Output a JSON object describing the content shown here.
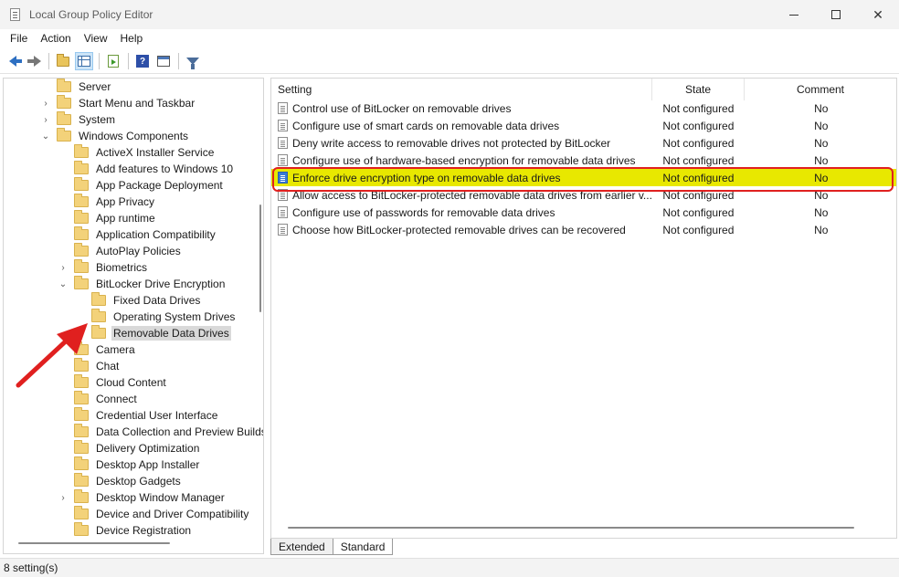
{
  "window": {
    "title": "Local Group Policy Editor",
    "controls": {
      "minimize": "minimize",
      "maximize": "maximize",
      "close": "✕"
    }
  },
  "menubar": [
    "File",
    "Action",
    "View",
    "Help"
  ],
  "toolbar": {
    "buttons": [
      "back-icon",
      "forward-icon",
      "up-folder-icon",
      "show-hide-tree-icon",
      "export-list-icon",
      "help-icon",
      "properties-icon",
      "filter-icon"
    ]
  },
  "tree": [
    {
      "label": "Server",
      "chevron": ""
    },
    {
      "label": "Start Menu and Taskbar",
      "chevron": "›"
    },
    {
      "label": "System",
      "chevron": "›"
    },
    {
      "label": "Windows Components",
      "chevron": "⌄"
    },
    {
      "label": "ActiveX Installer Service",
      "chevron": ""
    },
    {
      "label": "Add features to Windows 10",
      "chevron": ""
    },
    {
      "label": "App Package Deployment",
      "chevron": ""
    },
    {
      "label": "App Privacy",
      "chevron": ""
    },
    {
      "label": "App runtime",
      "chevron": ""
    },
    {
      "label": "Application Compatibility",
      "chevron": ""
    },
    {
      "label": "AutoPlay Policies",
      "chevron": ""
    },
    {
      "label": "Biometrics",
      "chevron": "›"
    },
    {
      "label": "BitLocker Drive Encryption",
      "chevron": "⌄"
    },
    {
      "label": "Fixed Data Drives",
      "chevron": ""
    },
    {
      "label": "Operating System Drives",
      "chevron": ""
    },
    {
      "label": "Removable Data Drives",
      "chevron": ""
    },
    {
      "label": "Camera",
      "chevron": ""
    },
    {
      "label": "Chat",
      "chevron": ""
    },
    {
      "label": "Cloud Content",
      "chevron": ""
    },
    {
      "label": "Connect",
      "chevron": ""
    },
    {
      "label": "Credential User Interface",
      "chevron": ""
    },
    {
      "label": "Data Collection and Preview Builds",
      "chevron": ""
    },
    {
      "label": "Delivery Optimization",
      "chevron": ""
    },
    {
      "label": "Desktop App Installer",
      "chevron": ""
    },
    {
      "label": "Desktop Gadgets",
      "chevron": ""
    },
    {
      "label": "Desktop Window Manager",
      "chevron": "›"
    },
    {
      "label": "Device and Driver Compatibility",
      "chevron": ""
    },
    {
      "label": "Device Registration",
      "chevron": ""
    }
  ],
  "list": {
    "headers": {
      "setting": "Setting",
      "state": "State",
      "comment": "Comment"
    },
    "rows": [
      {
        "setting": "Control use of BitLocker on removable drives",
        "state": "Not configured",
        "comment": "No"
      },
      {
        "setting": "Configure use of smart cards on removable data drives",
        "state": "Not configured",
        "comment": "No"
      },
      {
        "setting": "Deny write access to removable drives not protected by BitLocker",
        "state": "Not configured",
        "comment": "No"
      },
      {
        "setting": "Configure use of hardware-based encryption for removable data drives",
        "state": "Not configured",
        "comment": "No"
      },
      {
        "setting": "Enforce drive encryption type on removable data drives",
        "state": "Not configured",
        "comment": "No"
      },
      {
        "setting": "Allow access to BitLocker-protected removable data drives from earlier v...",
        "state": "Not configured",
        "comment": "No"
      },
      {
        "setting": "Configure use of passwords for removable data drives",
        "state": "Not configured",
        "comment": "No"
      },
      {
        "setting": "Choose how BitLocker-protected removable drives can be recovered",
        "state": "Not configured",
        "comment": "No"
      }
    ]
  },
  "tabs": [
    "Extended",
    "Standard"
  ],
  "status": "8 setting(s)",
  "colors": {
    "highlight": "#e8e800",
    "outline": "#e0201f",
    "arrow": "#e0201f"
  }
}
